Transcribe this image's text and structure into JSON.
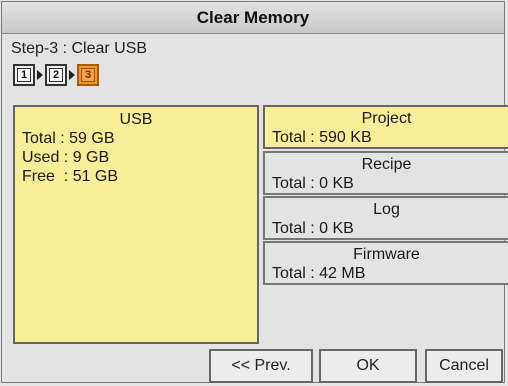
{
  "window": {
    "title": "Clear Memory"
  },
  "step": {
    "label": "Step-3 : Clear USB",
    "numbers": [
      "1",
      "2",
      "3"
    ],
    "current": 3
  },
  "usb_panel": {
    "title": "USB",
    "total_label": "Total",
    "total_value": "59 GB",
    "used_label": "Used",
    "used_value": "9 GB",
    "free_label": "Free",
    "free_value": "51 GB"
  },
  "categories": [
    {
      "name": "Project",
      "total": "Total : 590 KB",
      "selected": true
    },
    {
      "name": "Recipe",
      "total": "Total : 0 KB",
      "selected": false
    },
    {
      "name": "Log",
      "total": "Total : 0 KB",
      "selected": false
    },
    {
      "name": "Firmware",
      "total": "Total : 42 MB",
      "selected": false
    }
  ],
  "buttons": {
    "prev": "<< Prev.",
    "ok": "OK",
    "cancel": "Cancel"
  },
  "colors": {
    "selected_bg": "#f8ee97",
    "active_step": "#e7963c",
    "panel_bg": "#e3e3e3"
  }
}
